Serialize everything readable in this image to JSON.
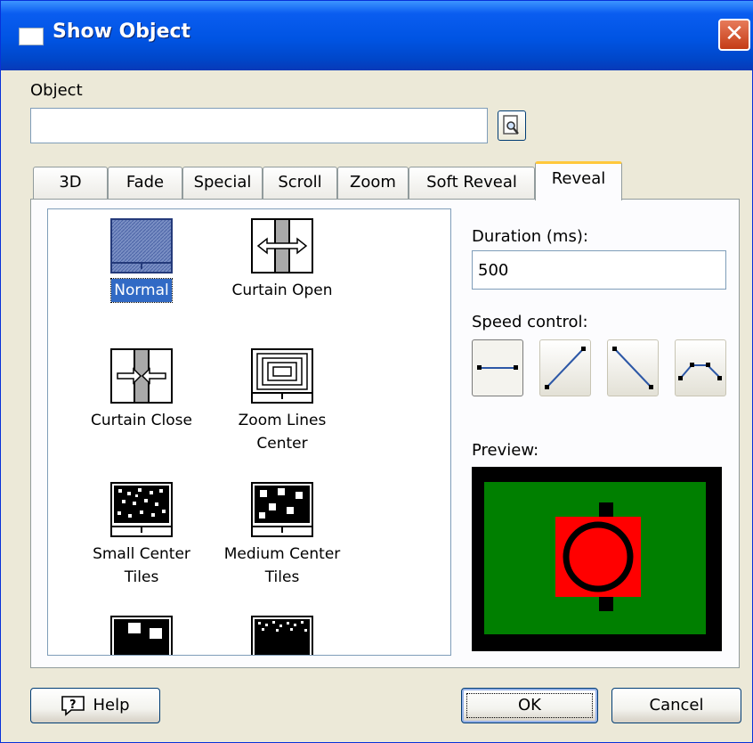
{
  "window": {
    "title": "Show Object",
    "close_glyph": "✕"
  },
  "object": {
    "label": "Object",
    "value": "",
    "placeholder": "",
    "browse_icon": "browse-magnifier-icon"
  },
  "tabs": [
    {
      "label": "3D"
    },
    {
      "label": "Fade"
    },
    {
      "label": "Special"
    },
    {
      "label": "Scroll"
    },
    {
      "label": "Zoom"
    },
    {
      "label": "Soft Reveal"
    },
    {
      "label": "Reveal",
      "active": true
    }
  ],
  "effects": [
    {
      "label": "Normal",
      "selected": true,
      "icon": "normal-icon"
    },
    {
      "label": "Curtain Open",
      "icon": "curtain-open-icon"
    },
    {
      "label": "Curtain Close",
      "icon": "curtain-close-icon"
    },
    {
      "label": "Zoom Lines Center",
      "icon": "zoom-lines-center-icon"
    },
    {
      "label": "Small Center Tiles",
      "icon": "small-center-tiles-icon"
    },
    {
      "label": "Medium Center Tiles",
      "icon": "medium-center-tiles-icon"
    },
    {
      "label": "",
      "icon": "large-tiles-icon"
    },
    {
      "label": "",
      "icon": "dots-icon"
    }
  ],
  "duration": {
    "label": "Duration (ms):",
    "value": "500"
  },
  "speed_control": {
    "label": "Speed control:",
    "options": [
      {
        "icon": "speed-constant-icon",
        "pressed": true
      },
      {
        "icon": "speed-accelerate-icon"
      },
      {
        "icon": "speed-decelerate-icon"
      },
      {
        "icon": "speed-ease-in-out-icon"
      }
    ]
  },
  "preview": {
    "label": "Preview:",
    "colors": {
      "border": "#000000",
      "field": "#007f00",
      "object": "#ff0000"
    }
  },
  "buttons": {
    "help": "Help",
    "ok": "OK",
    "cancel": "Cancel"
  },
  "colors": {
    "title_bar": "#0054e3",
    "dialog_face": "#ece9d8",
    "selection": "#316ac5",
    "tab_highlight": "#ffc83c"
  }
}
